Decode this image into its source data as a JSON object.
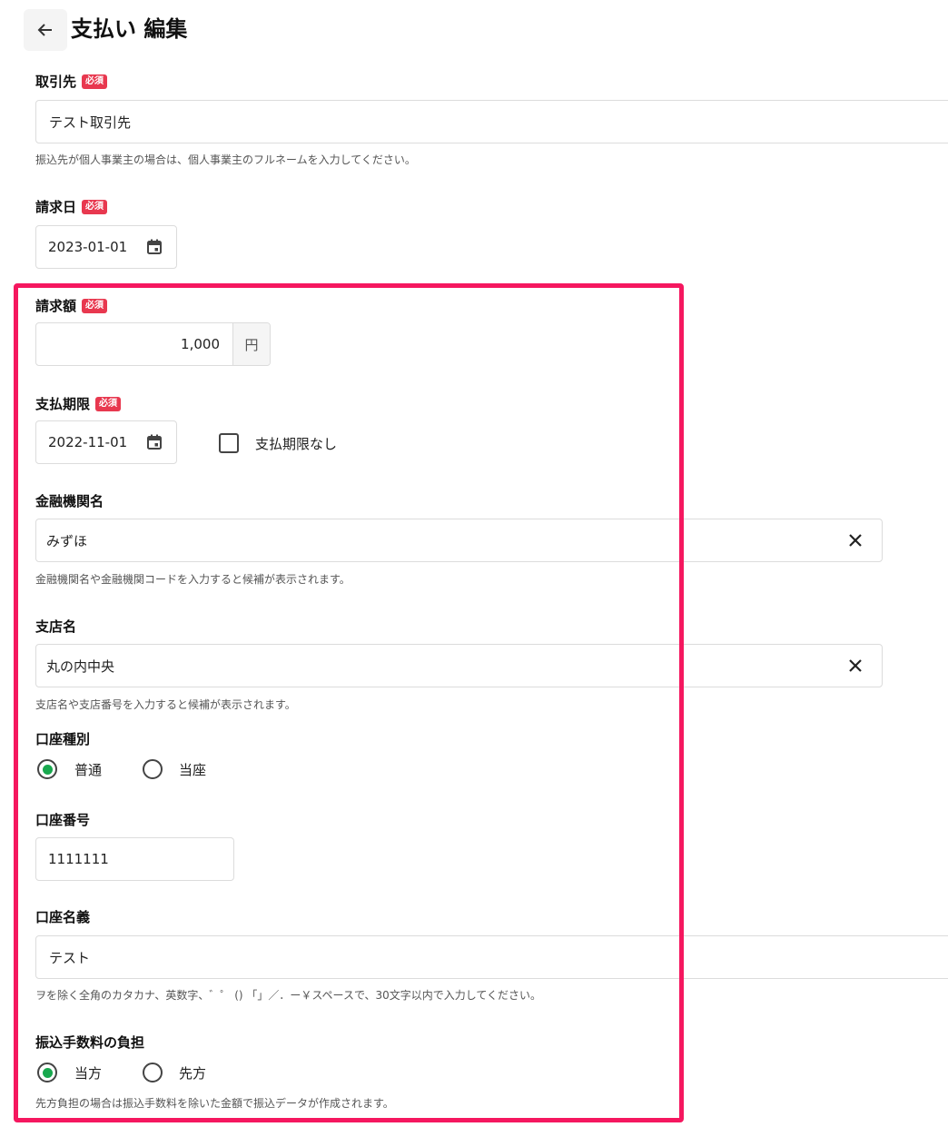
{
  "header": {
    "title": "支払い 編集"
  },
  "required_badge": "必須",
  "fields": {
    "partner": {
      "label": "取引先",
      "value": "テスト取引先",
      "help": "振込先が個人事業主の場合は、個人事業主のフルネームを入力してください。"
    },
    "invoice_date": {
      "label": "請求日",
      "value": "2023-01-01"
    },
    "amount": {
      "label": "請求額",
      "value": "1,000",
      "unit": "円"
    },
    "due_date": {
      "label": "支払期限",
      "value": "2022-11-01",
      "no_deadline_label": "支払期限なし",
      "no_deadline_checked": false
    },
    "bank": {
      "label": "金融機関名",
      "value": "みずほ",
      "help": "金融機関名や金融機関コードを入力すると候補が表示されます。"
    },
    "branch": {
      "label": "支店名",
      "value": "丸の内中央",
      "help": "支店名や支店番号を入力すると候補が表示されます。"
    },
    "account_type": {
      "label": "口座種別",
      "options": [
        "普通",
        "当座"
      ],
      "selected": "普通"
    },
    "account_number": {
      "label": "口座番号",
      "value": "1111111"
    },
    "account_holder": {
      "label": "口座名義",
      "value": "テスト",
      "help": "ヲを除く全角のカタカナ、英数字、゛゜ () 「」／．ー￥スペースで、30文字以内で入力してください。"
    },
    "fee_bearer": {
      "label": "振込手数料の負担",
      "options": [
        "当方",
        "先方"
      ],
      "selected": "当方",
      "help": "先方負担の場合は振込手数料を除いた金額で振込データが作成されます。"
    }
  },
  "colors": {
    "highlight": "#f5175f",
    "required": "#e8384f",
    "radio_selected": "#18a84e"
  }
}
